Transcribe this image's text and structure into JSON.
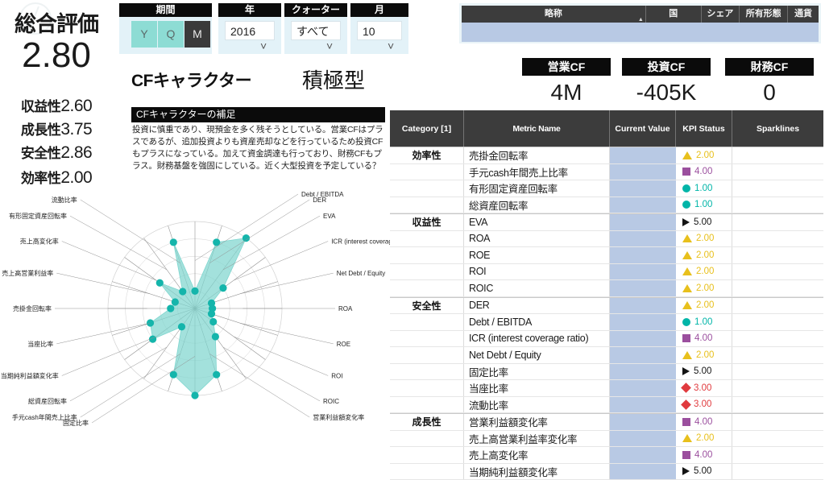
{
  "score_panel": {
    "title": "総合評価",
    "overall": "2.80",
    "metrics": [
      {
        "label": "収益性",
        "value": "2.60"
      },
      {
        "label": "成長性",
        "value": "3.75"
      },
      {
        "label": "安全性",
        "value": "2.86"
      },
      {
        "label": "効率性",
        "value": "2.00"
      }
    ]
  },
  "filters": {
    "period": {
      "title": "期間",
      "options": [
        "Y",
        "Q",
        "M"
      ],
      "selected": "M"
    },
    "year": {
      "title": "年",
      "value": "2016",
      "chevron": "chevron-down"
    },
    "quarter": {
      "title": "クォーター",
      "value": "すべて",
      "chevron": "chevron-down"
    },
    "month": {
      "title": "月",
      "value": "10",
      "chevron": "chevron-down"
    }
  },
  "company_table": {
    "columns": [
      "略称",
      "国",
      "シェア",
      "所有形態",
      "通貨"
    ],
    "sort_column": "略称",
    "sort_direction": "asc",
    "rows": []
  },
  "cash_flow": [
    {
      "label": "営業CF",
      "value": "4M"
    },
    {
      "label": "投資CF",
      "value": "-405K"
    },
    {
      "label": "財務CF",
      "value": "0"
    }
  ],
  "cf_character": {
    "title": "CFキャラクター",
    "type": "積極型",
    "note_title": "CFキャラクターの補足",
    "note_body": "投資に慎重であり、現預金を多く残そうとしている。営業CFはプラスであるが、追加投資よりも資産売却などを行っているため投資CFもプラスになっている。加えて資金調達も行っており、財務CFもプラス。財務基盤を強固にしている。近く大型投資を予定している？"
  },
  "metric_table": {
    "columns": [
      "Category [1]",
      "Metric Name",
      "Current Value",
      "KPI Status",
      "Sparklines"
    ],
    "rows": [
      {
        "category": "効率性",
        "name": "売掛金回転率",
        "current": "",
        "kpi": "2.00",
        "icon": "triangle-up",
        "color": "#e8c01c"
      },
      {
        "category": "",
        "name": "手元cash年間売上比率",
        "current": "",
        "kpi": "4.00",
        "icon": "square",
        "color": "#9b4f9e"
      },
      {
        "category": "",
        "name": "有形固定資産回転率",
        "current": "",
        "kpi": "1.00",
        "icon": "circle",
        "color": "#00b5a8"
      },
      {
        "category": "",
        "name": "総資産回転率",
        "current": "",
        "kpi": "1.00",
        "icon": "circle",
        "color": "#00b5a8"
      },
      {
        "category": "収益性",
        "name": "EVA",
        "current": "",
        "kpi": "5.00",
        "icon": "triangle-right",
        "color": "#141414"
      },
      {
        "category": "",
        "name": "ROA",
        "current": "",
        "kpi": "2.00",
        "icon": "triangle-up",
        "color": "#e8c01c"
      },
      {
        "category": "",
        "name": "ROE",
        "current": "",
        "kpi": "2.00",
        "icon": "triangle-up",
        "color": "#e8c01c"
      },
      {
        "category": "",
        "name": "ROI",
        "current": "",
        "kpi": "2.00",
        "icon": "triangle-up",
        "color": "#e8c01c"
      },
      {
        "category": "",
        "name": "ROIC",
        "current": "",
        "kpi": "2.00",
        "icon": "triangle-up",
        "color": "#e8c01c"
      },
      {
        "category": "安全性",
        "name": "DER",
        "current": "",
        "kpi": "2.00",
        "icon": "triangle-up",
        "color": "#e8c01c"
      },
      {
        "category": "",
        "name": "Debt / EBITDA",
        "current": "",
        "kpi": "1.00",
        "icon": "circle",
        "color": "#00b5a8"
      },
      {
        "category": "",
        "name": "ICR (interest coverage ratio)",
        "current": "",
        "kpi": "4.00",
        "icon": "square",
        "color": "#9b4f9e"
      },
      {
        "category": "",
        "name": "Net Debt / Equity",
        "current": "",
        "kpi": "2.00",
        "icon": "triangle-up",
        "color": "#e8c01c"
      },
      {
        "category": "",
        "name": "固定比率",
        "current": "",
        "kpi": "5.00",
        "icon": "triangle-right",
        "color": "#141414"
      },
      {
        "category": "",
        "name": "当座比率",
        "current": "",
        "kpi": "3.00",
        "icon": "diamond",
        "color": "#e03a3e"
      },
      {
        "category": "",
        "name": "流動比率",
        "current": "",
        "kpi": "3.00",
        "icon": "diamond",
        "color": "#e03a3e"
      },
      {
        "category": "成長性",
        "name": "営業利益額変化率",
        "current": "",
        "kpi": "4.00",
        "icon": "square",
        "color": "#9b4f9e"
      },
      {
        "category": "",
        "name": "売上高営業利益率変化率",
        "current": "",
        "kpi": "2.00",
        "icon": "triangle-up",
        "color": "#e8c01c"
      },
      {
        "category": "",
        "name": "売上高変化率",
        "current": "",
        "kpi": "4.00",
        "icon": "square",
        "color": "#9b4f9e"
      },
      {
        "category": "",
        "name": "当期純利益額変化率",
        "current": "",
        "kpi": "5.00",
        "icon": "triangle-right",
        "color": "#141414"
      }
    ]
  },
  "chart_data": {
    "type": "radar",
    "title": "",
    "fill_color": "#7fd6cf",
    "point_color": "#14b5ab",
    "rmax": 5,
    "rings": 5,
    "grid": true,
    "categories": [
      "Debt / EBITDA",
      "DER",
      "EVA",
      "ICR (interest coverage...",
      "Net Debt / Equity",
      "ROA",
      "ROE",
      "ROI",
      "ROIC",
      "営業利益額変化率",
      "固定比率",
      "手元cash年間売上比率",
      "総資産回転率",
      "当期純利益額変化率",
      "当座比率",
      "売掛金回転率",
      "売上高営業利益率",
      "売上高変化率",
      "有形固定資産回転率",
      "流動比率"
    ],
    "values": [
      1.0,
      4.0,
      5.0,
      2.0,
      1.0,
      1.0,
      1.0,
      1.3,
      2.0,
      4.0,
      5.0,
      4.0,
      1.3,
      3.0,
      2.7,
      1.4,
      1.2,
      2.5,
      1.2,
      4.0
    ]
  }
}
